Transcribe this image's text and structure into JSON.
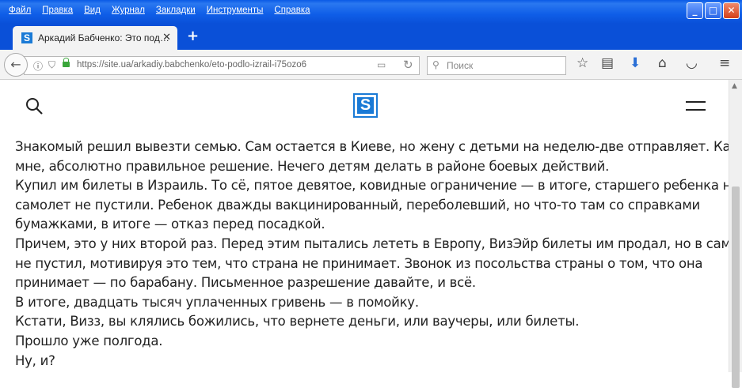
{
  "menu": [
    "Файл",
    "Правка",
    "Вид",
    "Журнал",
    "Закладки",
    "Инструменты",
    "Справка"
  ],
  "tab": {
    "title": "Аркадий Бабченко: Это под…",
    "favicon": "S"
  },
  "navbar": {
    "url": "https://site.ua/arkadiy.babchenko/eto-podlo-izrail-i75ozo6",
    "search_placeholder": "Поиск"
  },
  "site": {
    "logo": "S"
  },
  "article": {
    "lines": [
      "Знакомый решил вывезти семью. Сам остается в Киеве, но жену с детьми на неделю-две отправляет. Как по",
      "мне, абсолютно правильное решение. Нечего детям делать в районе боевых действий.",
      "Купил им билеты в Израиль. То сё, пятое девятое, ковидные ограничение — в итоге, старшего ребенка на",
      "самолет не пустили. Ребенок дважды вакцинированный, переболевший, но что-то там со справками",
      "бумажками, в итоге — отказ перед посадкой.",
      "Причем, это у них второй раз. Перед этим пытались лететь в Европу, ВизЭйр билеты им продал, но в самолет",
      "не пустил, мотивируя это тем, что страна не принимает. Звонок из посольства страны о том, что она",
      "принимает — по барабану. Письменное разрешение давайте, и всё.",
      "В итоге, двадцать тысяч уплаченных гривень — в помойку.",
      "Кстати, Визз, вы клялись божились, что вернете деньги, или ваучеры, или билеты.",
      "Прошло уже полгода.",
      "Ну, и?"
    ]
  }
}
